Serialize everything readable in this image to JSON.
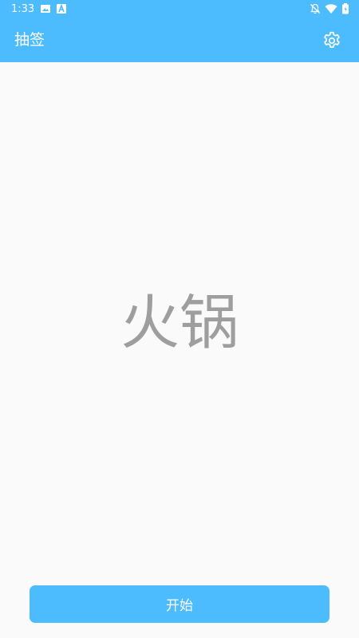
{
  "status_bar": {
    "time": "1:33",
    "icons": [
      "image-icon",
      "a-letter-icon",
      "notifications-off-icon",
      "wifi-icon",
      "battery-icon"
    ]
  },
  "toolbar": {
    "title": "抽签",
    "settings_icon": "gear-icon"
  },
  "main": {
    "result_text": "火锅"
  },
  "footer": {
    "start_label": "开始"
  },
  "colors": {
    "accent": "#4dbcff",
    "background": "#fafafa",
    "result_text": "#9e9e9e"
  }
}
